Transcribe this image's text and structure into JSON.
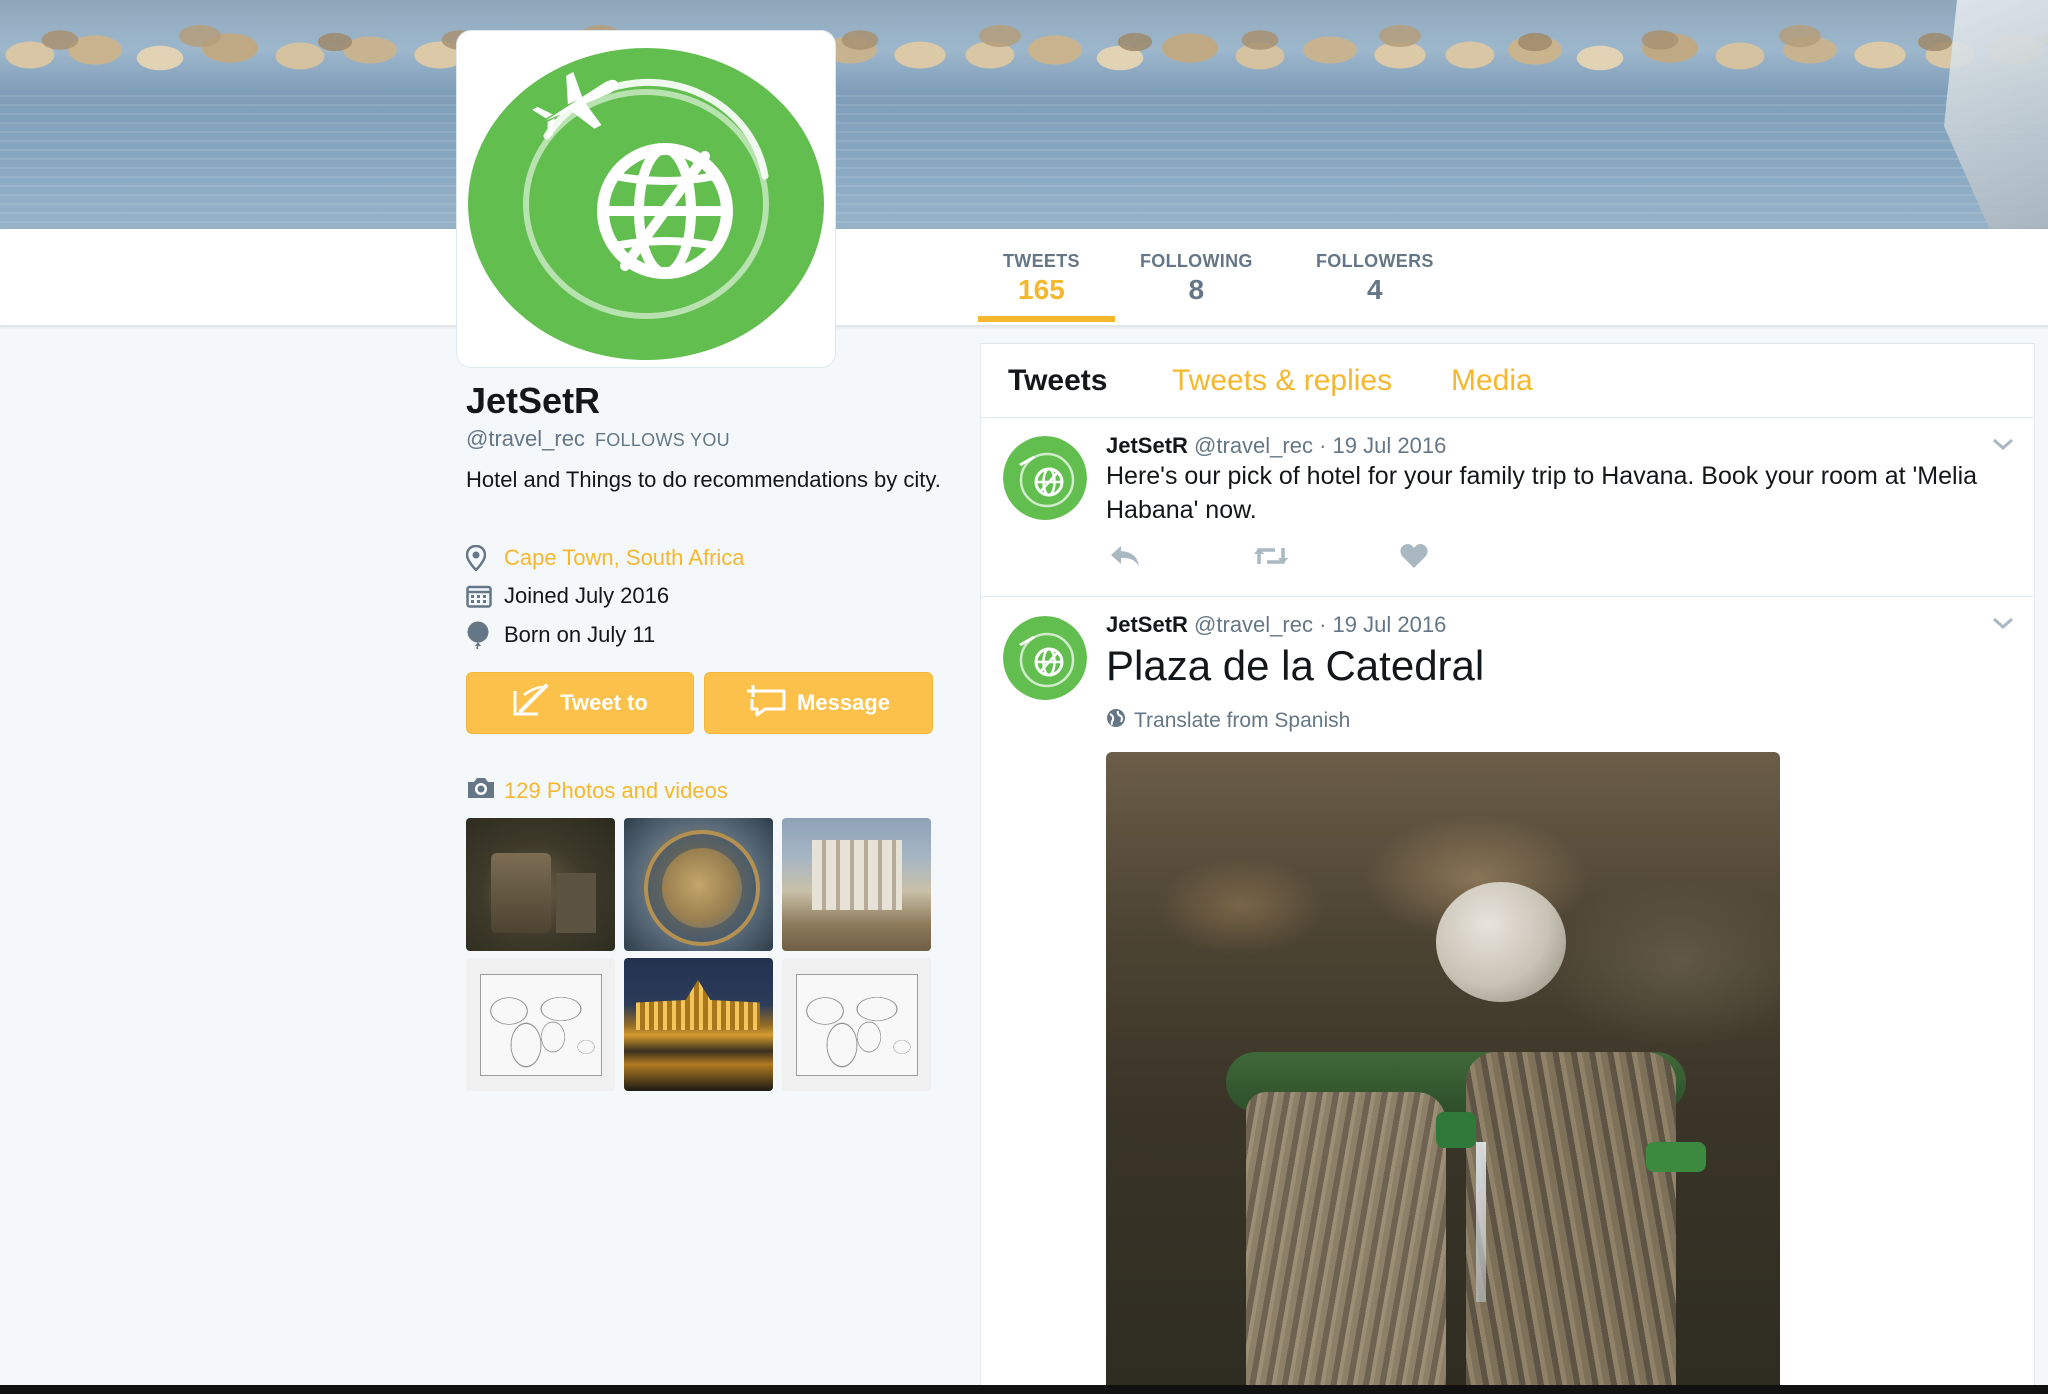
{
  "profile": {
    "name": "JetSetR",
    "handle": "@travel_rec",
    "follows_you": "FOLLOWS YOU",
    "bio": "Hotel and Things to do recommendations by city.",
    "location": "Cape Town, South Africa",
    "joined": "Joined July 2016",
    "born": "Born on July 11"
  },
  "stats": [
    {
      "label": "TWEETS",
      "value": "165"
    },
    {
      "label": "FOLLOWING",
      "value": "8"
    },
    {
      "label": "FOLLOWERS",
      "value": "4"
    }
  ],
  "buttons": {
    "tweet_to": "Tweet to",
    "message": "Message"
  },
  "photos": {
    "label": "129 Photos and videos"
  },
  "tabs": [
    "Tweets",
    "Tweets & replies",
    "Media"
  ],
  "tweets": [
    {
      "name": "JetSetR",
      "handle": "@travel_rec",
      "date": "· 19 Jul 2016",
      "text": "Here's our pick of hotel for your family trip to Havana. Book your room at 'Melia Habana' now."
    },
    {
      "name": "JetSetR",
      "handle": "@travel_rec",
      "date": "· 19 Jul 2016",
      "text": "Plaza de la Catedral",
      "translate": "Translate from Spanish"
    }
  ],
  "colors": {
    "accent": "#f5b72b",
    "button": "#fbc14a",
    "brand_green": "#62bf4f",
    "muted": "#657786"
  },
  "icons": [
    "location-pin-icon",
    "calendar-icon",
    "balloon-icon",
    "compose-icon",
    "message-icon",
    "camera-icon",
    "reply-icon",
    "retweet-icon",
    "like-icon",
    "chevron-down-icon",
    "globe-icon"
  ]
}
